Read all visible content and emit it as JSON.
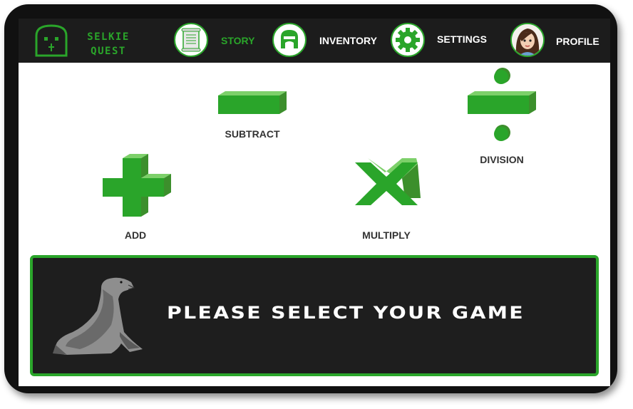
{
  "app": {
    "logo_line1": "SELKIE",
    "logo_line2": "QUEST",
    "logo_icon": "ghost-face-icon"
  },
  "nav": {
    "items": [
      {
        "label": "STORY",
        "icon": "scroll-icon",
        "active": true
      },
      {
        "label": "INVENTORY",
        "icon": "helmet-icon",
        "active": false
      },
      {
        "label": "SETTINGS",
        "icon": "gear-icon",
        "active": false
      },
      {
        "label": "PROFILE",
        "icon": "avatar",
        "active": false
      }
    ]
  },
  "games": {
    "subtract": "SUBTRACT",
    "division": "DIVISION",
    "add": "ADD",
    "multiply": "MULTIPLY"
  },
  "prompt": {
    "text": "PLEASE SELECT YOUR GAME",
    "mascot": "seal-icon"
  },
  "colors": {
    "accent": "#2aa52a",
    "bar": "#1c1c1c",
    "frame": "#111111",
    "panel": "#1e1e1e"
  }
}
